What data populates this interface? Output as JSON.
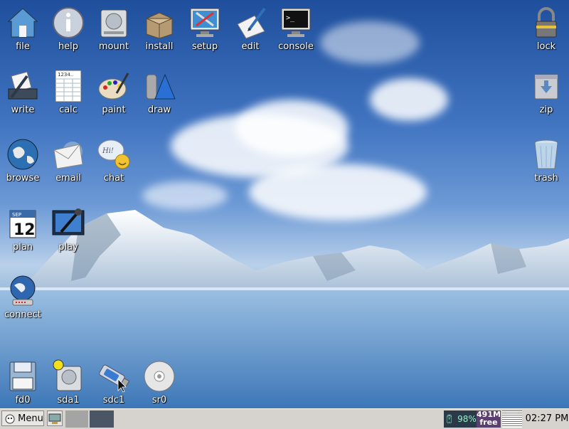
{
  "desktop": {
    "icons": {
      "file": "file",
      "help": "help",
      "mount": "mount",
      "install": "install",
      "setup": "setup",
      "edit": "edit",
      "console": "console",
      "lock": "lock",
      "write": "write",
      "calc": "calc",
      "paint": "paint",
      "draw": "draw",
      "zip": "zip",
      "browse": "browse",
      "email": "email",
      "chat": "chat",
      "trash": "trash",
      "plan": "plan",
      "play": "play",
      "connect": "connect",
      "fd0": "fd0",
      "sda1": "sda1",
      "sdc1": "sdc1",
      "sr0": "sr0"
    },
    "calendar_month": "SEP",
    "calendar_day": "12",
    "calc_digits": "1234.."
  },
  "taskbar": {
    "menu_label": "Menu",
    "battery": "98%",
    "memory_amount": "491M",
    "memory_label": "free",
    "clock": "02:27 PM"
  },
  "colors": {
    "sky_top": "#1f4f9c",
    "taskbar": "#d6d3ce",
    "tray": "#2b3a48",
    "memory": "#5a3f6f"
  }
}
